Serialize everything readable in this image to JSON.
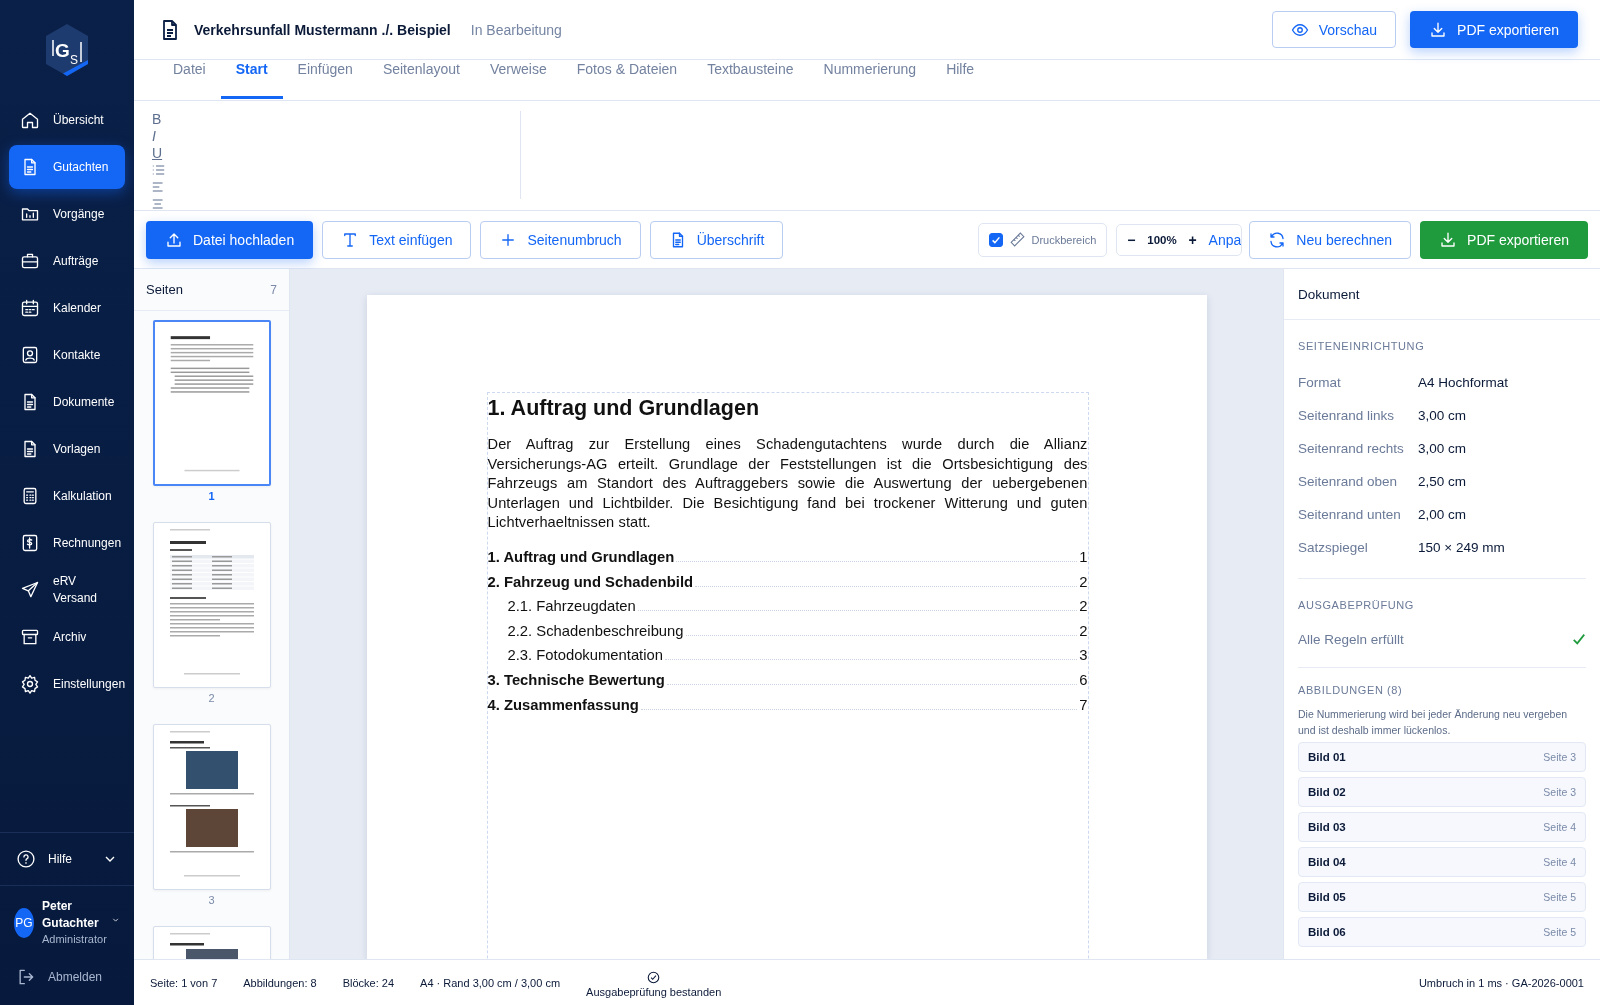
{
  "logo": {
    "main": "G",
    "sub": "S"
  },
  "nav": [
    {
      "label": "Übersicht",
      "selected": false
    },
    {
      "label": "Gutachten",
      "selected": true
    },
    {
      "label": "Vorgänge",
      "selected": false
    },
    {
      "label": "Aufträge",
      "selected": false
    },
    {
      "label": "Kalender",
      "selected": false
    },
    {
      "label": "Kontakte",
      "selected": false
    },
    {
      "label": "Dokumente",
      "selected": false
    },
    {
      "label": "Vorlagen",
      "selected": false
    },
    {
      "label": "Kalkulation",
      "selected": false
    },
    {
      "label": "Rechnungen",
      "selected": false
    },
    {
      "label": "eRV\nVersand",
      "selected": false
    },
    {
      "label": "Archiv",
      "selected": false
    },
    {
      "label": "Einstellungen",
      "selected": false
    }
  ],
  "help": {
    "label": "Hilfe",
    "expanded": false
  },
  "user": {
    "initials": "PG",
    "name": "Peter Gutachter",
    "role": "Administrator"
  },
  "logout": "Abmelden",
  "header": {
    "title": "Verkehrsunfall Mustermann ./. Beispiel",
    "status": "In Bearbeitung",
    "preview": "Vorschau",
    "export": "PDF exportieren"
  },
  "tabs": [
    {
      "label": "Datei",
      "selected": false
    },
    {
      "label": "Start",
      "selected": true
    },
    {
      "label": "Einfügen",
      "selected": false
    },
    {
      "label": "Seitenlayout",
      "selected": false
    },
    {
      "label": "Verweise",
      "selected": false
    },
    {
      "label": "Fotos & Dateien",
      "selected": false
    },
    {
      "label": "Textbausteine",
      "selected": false
    },
    {
      "label": "Nummerierung",
      "selected": false
    },
    {
      "label": "Hilfe",
      "selected": false
    }
  ],
  "format_buttons": [
    "B",
    "I",
    "U"
  ],
  "toolbar": {
    "actions": [
      "Datei hochladen",
      "Text einfügen",
      "Seitenumbruch",
      "Überschrift"
    ],
    "print_area": {
      "label": "Druckbereich",
      "checked": true
    },
    "zoom": {
      "minus": "−",
      "value": "100%",
      "plus": "+",
      "fit": "Anpa"
    },
    "recalc": "Neu berechnen",
    "export": "PDF exportieren"
  },
  "pages_panel": {
    "title": "Seiten",
    "count": "7",
    "pages": [
      {
        "kind": "text",
        "label": "1",
        "selected": true
      },
      {
        "kind": "table",
        "label": "2",
        "selected": false
      },
      {
        "kind": "photos",
        "label": "3",
        "selected": false
      },
      {
        "kind": "photo",
        "selected": false
      }
    ]
  },
  "document": {
    "heading": "1. Auftrag und Grundlagen",
    "paragraph": "Der Auftrag zur Erstellung eines Schadengutachtens wurde durch die Allianz Versicherungs-AG erteilt. Grundlage der Feststellungen ist die Ortsbesichtigung des Fahrzeugs am Standort des Auftraggebers sowie die Auswertung der uebergebenen Unterlagen und Lichtbilder. Die Besichtigung fand bei trockener Witterung und guten Lichtverhaeltnissen statt.",
    "toc": [
      {
        "title": "1. Auftrag und Grundlagen",
        "page": "1"
      },
      {
        "title": "2. Fahrzeug und Schadenbild",
        "page": "2",
        "children": [
          {
            "title": "2.1. Fahrzeugdaten",
            "page": "2"
          },
          {
            "title": "2.2. Schadenbeschreibung",
            "page": "2"
          },
          {
            "title": "2.3. Fotodokumentation",
            "page": "3"
          }
        ]
      },
      {
        "title": "3. Technische Bewertung",
        "page": "6"
      },
      {
        "title": "4. Zusammenfassung",
        "page": "7"
      }
    ]
  },
  "inspector": {
    "title": "Dokument",
    "page_setup": {
      "heading": "SEITENEINRICHTUNG",
      "rows": [
        {
          "label": "Format",
          "value": "A4 Hochformat"
        },
        {
          "label": "Seitenrand links",
          "value": "3,00 cm"
        },
        {
          "label": "Seitenrand rechts",
          "value": "3,00 cm"
        },
        {
          "label": "Seitenrand oben",
          "value": "2,50 cm"
        },
        {
          "label": "Seitenrand unten",
          "value": "2,00 cm"
        },
        {
          "label": "Satzspiegel",
          "value": "150 × 249 mm"
        }
      ]
    },
    "check": {
      "heading": "AUSGABEPRÜFUNG",
      "label": "Alle Regeln erfüllt",
      "passed": true
    },
    "figures": {
      "heading": "ABBILDUNGEN (8)",
      "note": "Die Nummerierung wird bei jeder Änderung neu vergeben und ist deshalb immer lückenlos.",
      "items": [
        {
          "name": "Bild 01",
          "page": "Seite 3"
        },
        {
          "name": "Bild 02",
          "page": "Seite 3"
        },
        {
          "name": "Bild 03",
          "page": "Seite 4"
        },
        {
          "name": "Bild 04",
          "page": "Seite 4"
        },
        {
          "name": "Bild 05",
          "page": "Seite 5"
        },
        {
          "name": "Bild 06",
          "page": "Seite 5"
        }
      ]
    }
  },
  "status_bar": {
    "items": [
      "Seite: 1 von 7",
      "Abbildungen: 8",
      "Blöcke: 24",
      "A4 · Rand 3,00 cm / 3,00 cm"
    ],
    "check": "Ausgabeprüfung bestanden",
    "right": "Umbruch in 1 ms · GA-2026-0001"
  }
}
